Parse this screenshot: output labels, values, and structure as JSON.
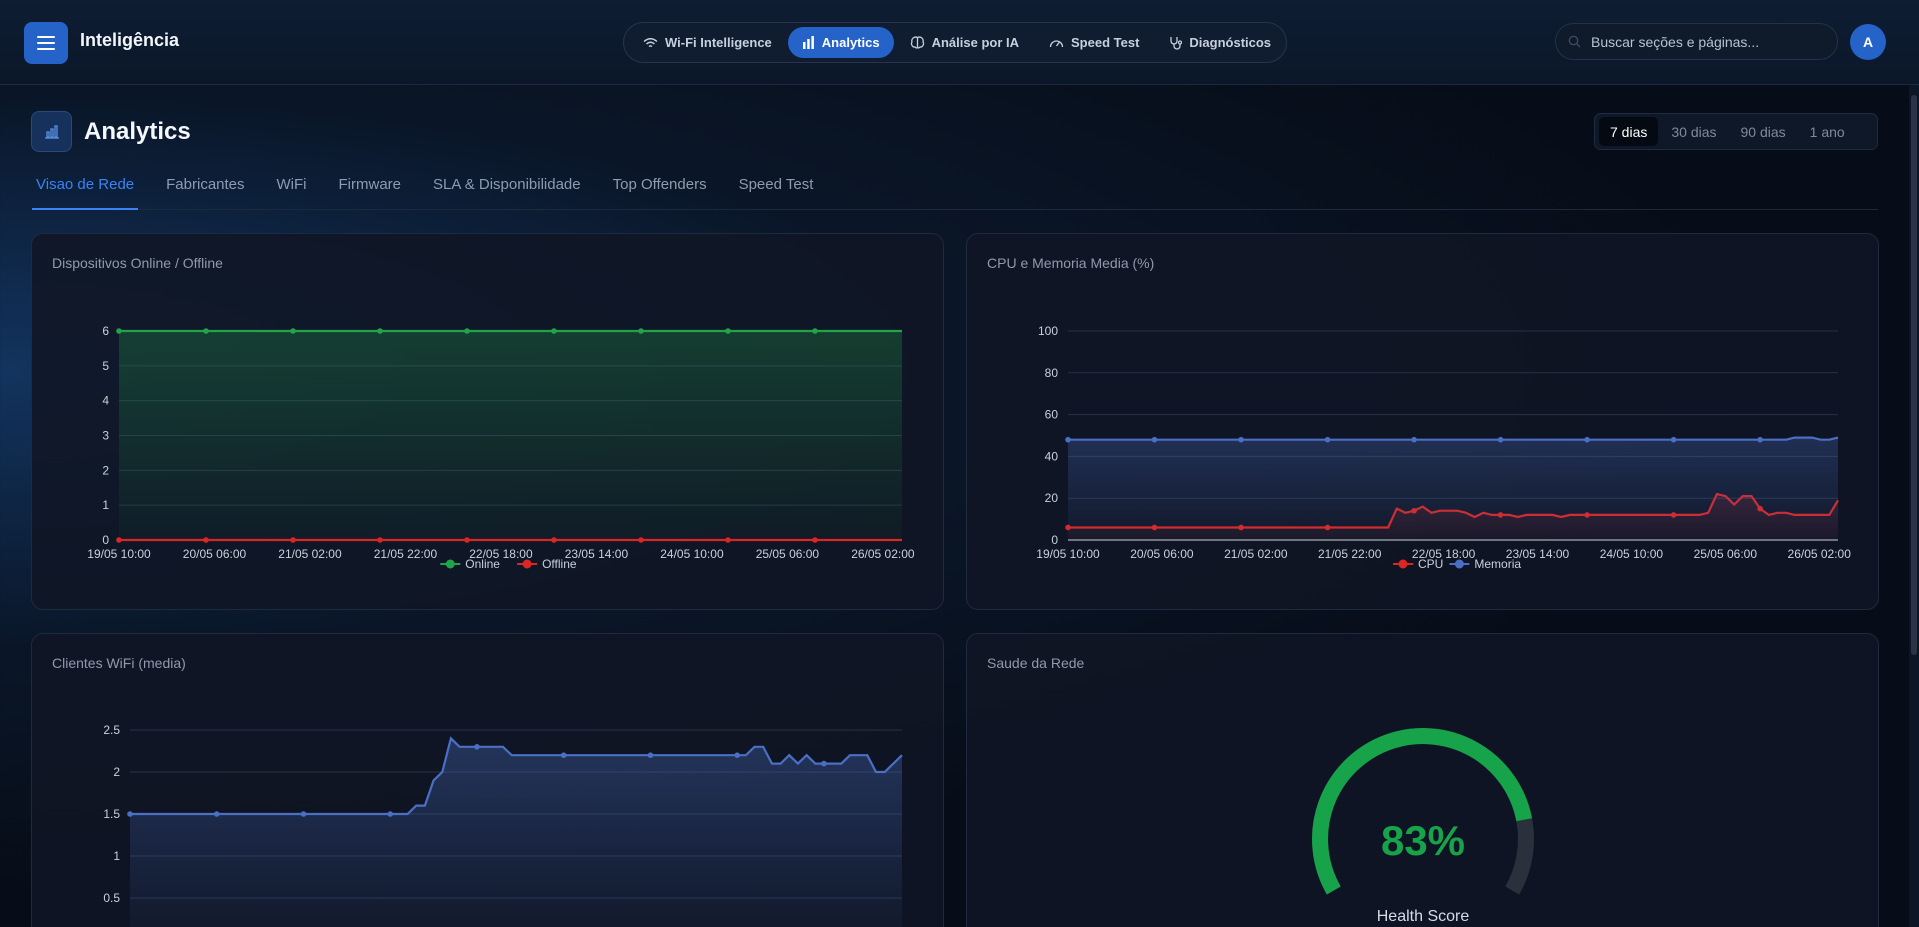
{
  "app": {
    "title": "Inteligência",
    "search_placeholder": "Buscar seções e páginas...",
    "avatar_initial": "A"
  },
  "nav": [
    {
      "label": "Wi-Fi Intelligence",
      "icon": "wifi-icon",
      "active": false
    },
    {
      "label": "Analytics",
      "icon": "bar-chart-icon",
      "active": true
    },
    {
      "label": "Análise por IA",
      "icon": "brain-icon",
      "active": false
    },
    {
      "label": "Speed Test",
      "icon": "speedometer-icon",
      "active": false
    },
    {
      "label": "Diagnósticos",
      "icon": "stethoscope-icon",
      "active": false
    }
  ],
  "page": {
    "title": "Analytics",
    "ranges": [
      "7 dias",
      "30 dias",
      "90 dias",
      "1 ano"
    ],
    "active_range": "7 dias",
    "tabs": [
      "Visao de Rede",
      "Fabricantes",
      "WiFi",
      "Firmware",
      "SLA & Disponibilidade",
      "Top Offenders",
      "Speed Test"
    ],
    "active_tab": "Visao de Rede"
  },
  "colors": {
    "accent": "#2563c9",
    "online": "#22a34a",
    "offline": "#dc2626",
    "cpu": "#dc2626",
    "memory": "#4a6fc4",
    "clients": "#4a6fc4",
    "gauge": "#16a34a"
  },
  "cards": {
    "devices": {
      "title": "Dispositivos Online / Offline"
    },
    "cpu_mem": {
      "title": "CPU e Memoria Media (%)"
    },
    "clients": {
      "title": "Clientes WiFi (media)"
    },
    "health": {
      "title": "Saude da Rede",
      "value_text": "83%",
      "label": "Health Score"
    }
  },
  "chart_data": [
    {
      "type": "area",
      "title": "Dispositivos Online / Offline",
      "x_ticks": [
        "19/05 10:00",
        "20/05 06:00",
        "21/05 02:00",
        "21/05 22:00",
        "22/05 18:00",
        "23/05 14:00",
        "24/05 10:00",
        "25/05 06:00",
        "26/05 02:00"
      ],
      "ylim": [
        0,
        6
      ],
      "y_ticks": [
        0,
        1,
        2,
        3,
        4,
        5,
        6
      ],
      "legend": "bottom-center",
      "grid": true,
      "series": [
        {
          "name": "Online",
          "values": [
            6,
            6,
            6,
            6,
            6,
            6,
            6,
            6,
            6,
            6
          ]
        },
        {
          "name": "Offline",
          "values": [
            0,
            0,
            0,
            0,
            0,
            0,
            0,
            0,
            0,
            0
          ]
        }
      ]
    },
    {
      "type": "line",
      "title": "CPU e Memoria Media (%)",
      "x_ticks": [
        "19/05 10:00",
        "20/05 06:00",
        "21/05 02:00",
        "21/05 22:00",
        "22/05 18:00",
        "23/05 14:00",
        "24/05 10:00",
        "25/05 06:00",
        "26/05 02:00"
      ],
      "ylim": [
        0,
        100
      ],
      "y_ticks": [
        0,
        20,
        40,
        60,
        80,
        100
      ],
      "legend": "bottom-center",
      "grid": true,
      "series": [
        {
          "name": "CPU",
          "values": [
            6,
            6,
            6,
            6,
            6,
            6,
            6,
            6,
            6,
            6,
            6,
            6,
            6,
            6,
            6,
            6,
            6,
            6,
            6,
            6,
            6,
            6,
            6,
            6,
            6,
            6,
            6,
            6,
            6,
            6,
            6,
            6,
            6,
            6,
            6,
            6,
            6,
            6,
            15,
            13,
            14,
            16,
            13,
            14,
            14,
            14,
            13,
            11,
            13,
            12,
            12,
            12,
            11,
            12,
            12,
            12,
            12,
            11,
            12,
            12,
            12,
            12,
            12,
            12,
            12,
            12,
            12,
            12,
            12,
            12,
            12,
            12,
            12,
            12,
            13,
            22,
            21,
            17,
            21,
            21,
            15,
            12,
            13,
            13,
            12,
            12,
            12,
            12,
            12,
            19
          ]
        },
        {
          "name": "Memoria",
          "values": [
            48,
            48,
            48,
            48,
            48,
            48,
            48,
            48,
            48,
            48,
            48,
            48,
            48,
            48,
            48,
            48,
            48,
            48,
            48,
            48,
            48,
            48,
            48,
            48,
            48,
            48,
            48,
            48,
            48,
            48,
            48,
            48,
            48,
            48,
            48,
            48,
            48,
            48,
            48,
            48,
            48,
            48,
            48,
            48,
            48,
            48,
            48,
            48,
            48,
            48,
            48,
            48,
            48,
            48,
            48,
            48,
            48,
            48,
            48,
            48,
            48,
            48,
            48,
            48,
            48,
            48,
            48,
            48,
            48,
            48,
            48,
            48,
            48,
            48,
            48,
            48,
            48,
            48,
            48,
            48,
            48,
            48,
            48,
            48,
            49,
            49,
            49,
            48,
            48,
            49
          ]
        }
      ]
    },
    {
      "type": "area",
      "title": "Clientes WiFi (media)",
      "ylim": [
        0,
        2.5
      ],
      "y_ticks": [
        0.5,
        1,
        1.5,
        2,
        2.5
      ],
      "grid": true,
      "series": [
        {
          "name": "",
          "values": [
            1.5,
            1.5,
            1.5,
            1.5,
            1.5,
            1.5,
            1.5,
            1.5,
            1.5,
            1.5,
            1.5,
            1.5,
            1.5,
            1.5,
            1.5,
            1.5,
            1.5,
            1.5,
            1.5,
            1.5,
            1.5,
            1.5,
            1.5,
            1.5,
            1.5,
            1.5,
            1.5,
            1.5,
            1.5,
            1.5,
            1.5,
            1.5,
            1.5,
            1.6,
            1.6,
            1.9,
            2.0,
            2.4,
            2.3,
            2.3,
            2.3,
            2.3,
            2.3,
            2.3,
            2.2,
            2.2,
            2.2,
            2.2,
            2.2,
            2.2,
            2.2,
            2.2,
            2.2,
            2.2,
            2.2,
            2.2,
            2.2,
            2.2,
            2.2,
            2.2,
            2.2,
            2.2,
            2.2,
            2.2,
            2.2,
            2.2,
            2.2,
            2.2,
            2.2,
            2.2,
            2.2,
            2.2,
            2.3,
            2.3,
            2.1,
            2.1,
            2.2,
            2.1,
            2.2,
            2.1,
            2.1,
            2.1,
            2.1,
            2.2,
            2.2,
            2.2,
            2.0,
            2.0,
            2.1,
            2.2
          ]
        }
      ]
    },
    {
      "type": "gauge",
      "title": "Saude da Rede",
      "value": 83,
      "max": 100,
      "label": "Health Score"
    }
  ]
}
